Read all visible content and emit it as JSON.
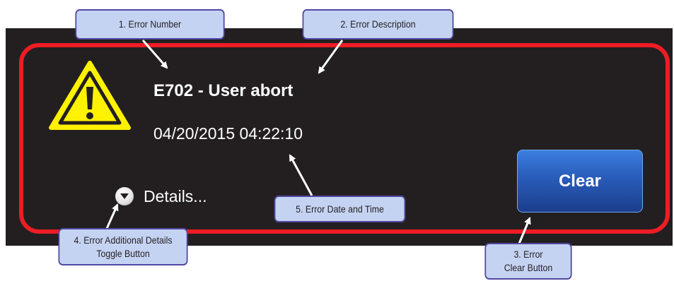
{
  "error": {
    "title": "E702 - User abort",
    "datetime": "04/20/2015 04:22:10",
    "details_label": "Details...",
    "clear_label": "Clear"
  },
  "callouts": {
    "error_number": "1. Error Number",
    "error_description": "2. Error Description",
    "clear_button": "3. Error\nClear Button",
    "details_toggle": "4. Error Additional Details\nToggle Button",
    "date_time": "5. Error Date and Time"
  },
  "icons": {
    "warning": "warning-triangle-icon",
    "toggle": "chevron-down-icon"
  },
  "colors": {
    "panel_background": "#231f20",
    "frame_red": "#ee1c25",
    "warning_yellow": "#fff200",
    "button_blue": "#2a5fbd",
    "callout_fill": "#c5d3f3",
    "callout_border": "#5148a1"
  }
}
